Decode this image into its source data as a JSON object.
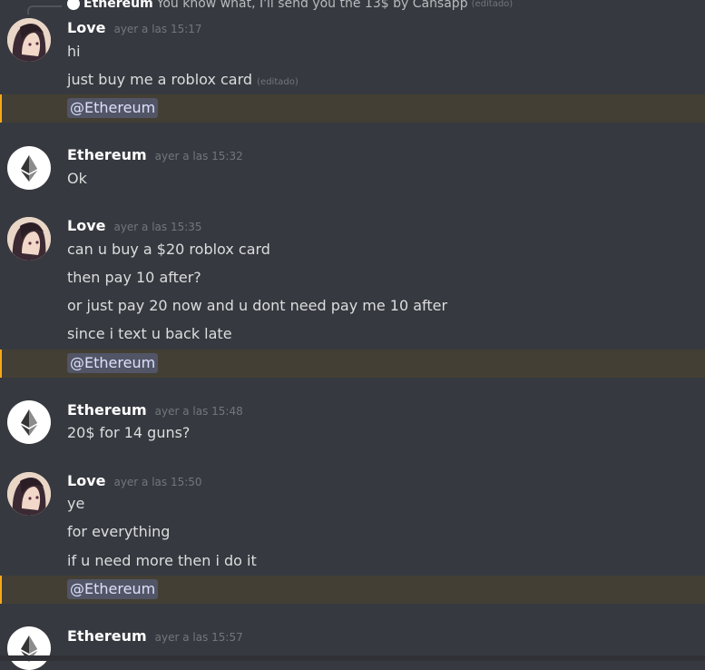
{
  "reply": {
    "author": "Ethereum",
    "text": "You know what, I'll send you the 13$ by Cansapp",
    "edited": "(editado)"
  },
  "messages": [
    {
      "author": "Love",
      "timestamp": "ayer a las 15:17",
      "lines": [
        "hi",
        "just buy me a roblox card"
      ],
      "edited": "(editado)",
      "mention": "@Ethereum"
    },
    {
      "author": "Ethereum",
      "timestamp": "ayer a las 15:32",
      "lines": [
        "Ok"
      ]
    },
    {
      "author": "Love",
      "timestamp": "ayer a las 15:35",
      "lines": [
        "can u buy a $20 roblox card",
        "then pay 10 after?",
        "or just pay 20 now and u dont need pay me 10 after",
        "since i text u back late"
      ],
      "mention": "@Ethereum"
    },
    {
      "author": "Ethereum",
      "timestamp": "ayer a las 15:48",
      "lines": [
        "20$ for 14 guns?"
      ]
    },
    {
      "author": "Love",
      "timestamp": "ayer a las 15:50",
      "lines": [
        "ye",
        "for everything",
        "if u need more then i do it"
      ],
      "mention": "@Ethereum"
    },
    {
      "author": "Ethereum",
      "timestamp": "ayer a las 15:57",
      "lines": []
    }
  ],
  "colors": {
    "background": "#36393f",
    "mention_highlight": "#443f34",
    "mention_accent": "#faa81a",
    "author": "#ffffff",
    "timestamp": "#72767d"
  }
}
